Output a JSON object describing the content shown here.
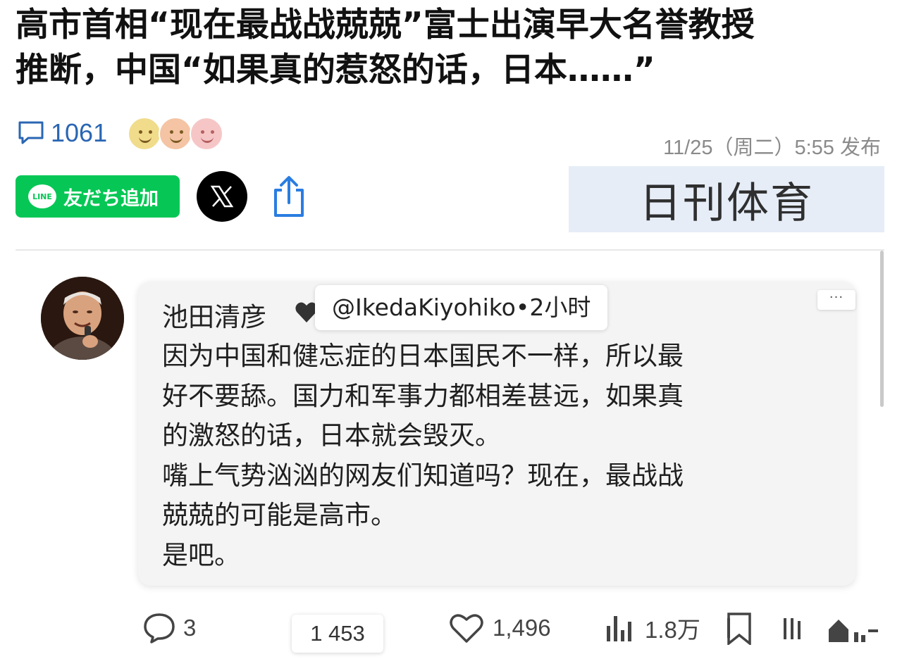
{
  "article": {
    "headline_line1": "高市首相“现在最战战兢兢”富士出演早大名誉教授",
    "headline_line2": "推断，中国“如果真的惹怒的话，日本……”",
    "comment_count": "1061",
    "published": "11/25（周二）5:55 发布"
  },
  "share": {
    "line_label": "友だち追加",
    "line_logo_text": "LINE",
    "x_icon": "x-logo-icon",
    "share_icon": "share-icon"
  },
  "brand": {
    "name": "日刊体育"
  },
  "tweet": {
    "author": "池田清彦",
    "handle_time": "@IkedaKiyohiko•2小时",
    "menu": "···",
    "lines": [
      "因为中国和健忘症的日本国民不一样，所以最",
      "好不要舔。国力和军事力都相差甚远，如果真",
      "的激怒的话，日本就会毁灭。",
      "嘴上气势汹汹的网友们知道吗？现在，最战战",
      "兢兢的可能是高市。",
      "是吧。"
    ],
    "stats": {
      "replies": "3",
      "views_popup": "1 453",
      "likes": "1,496",
      "views": "1.8万"
    }
  },
  "colors": {
    "accent_blue": "#2a66b3",
    "line_green": "#06c755",
    "brand_bg": "#e6edf7"
  }
}
